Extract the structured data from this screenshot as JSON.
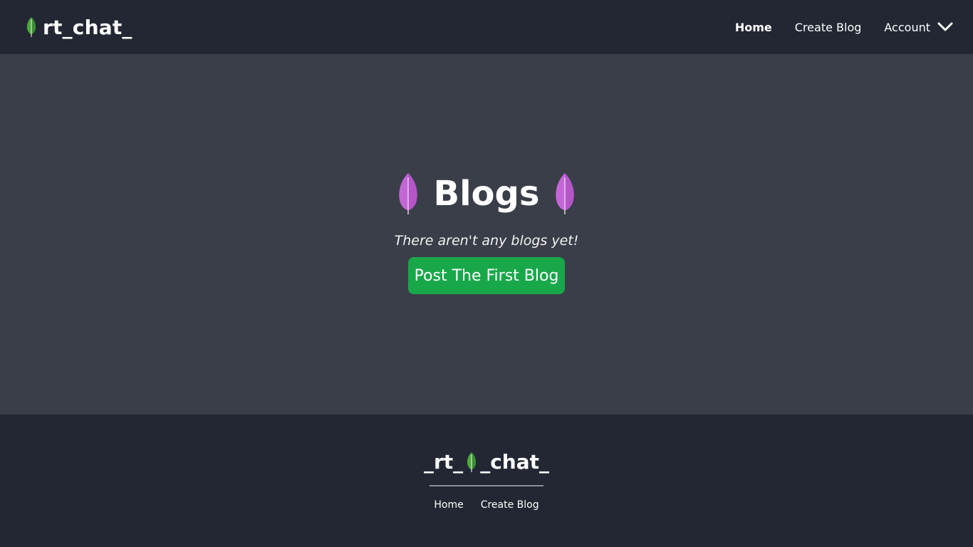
{
  "brand": {
    "name": "rt_chat_",
    "icon": "leaf-icon",
    "leaf_color": "#4aa93c"
  },
  "nav": {
    "home_label": "Home",
    "create_blog_label": "Create Blog",
    "account_label": "Account",
    "account_icon": "chevron-down-icon"
  },
  "main": {
    "title": "Blogs",
    "title_icon": "leaf-icon",
    "title_leaf_color": "#c467d6",
    "empty_message": "There aren't any blogs yet!",
    "post_button_label": "Post The First Blog",
    "post_button_color": "#18a84a"
  },
  "footer": {
    "brand_prefix": "_rt_",
    "brand_suffix": "_chat_",
    "brand_icon": "leaf-icon",
    "home_label": "Home",
    "create_blog_label": "Create Blog"
  },
  "colors": {
    "navbar_bg": "#222733",
    "page_bg": "#3a3e48",
    "footer_bg": "#222733"
  }
}
